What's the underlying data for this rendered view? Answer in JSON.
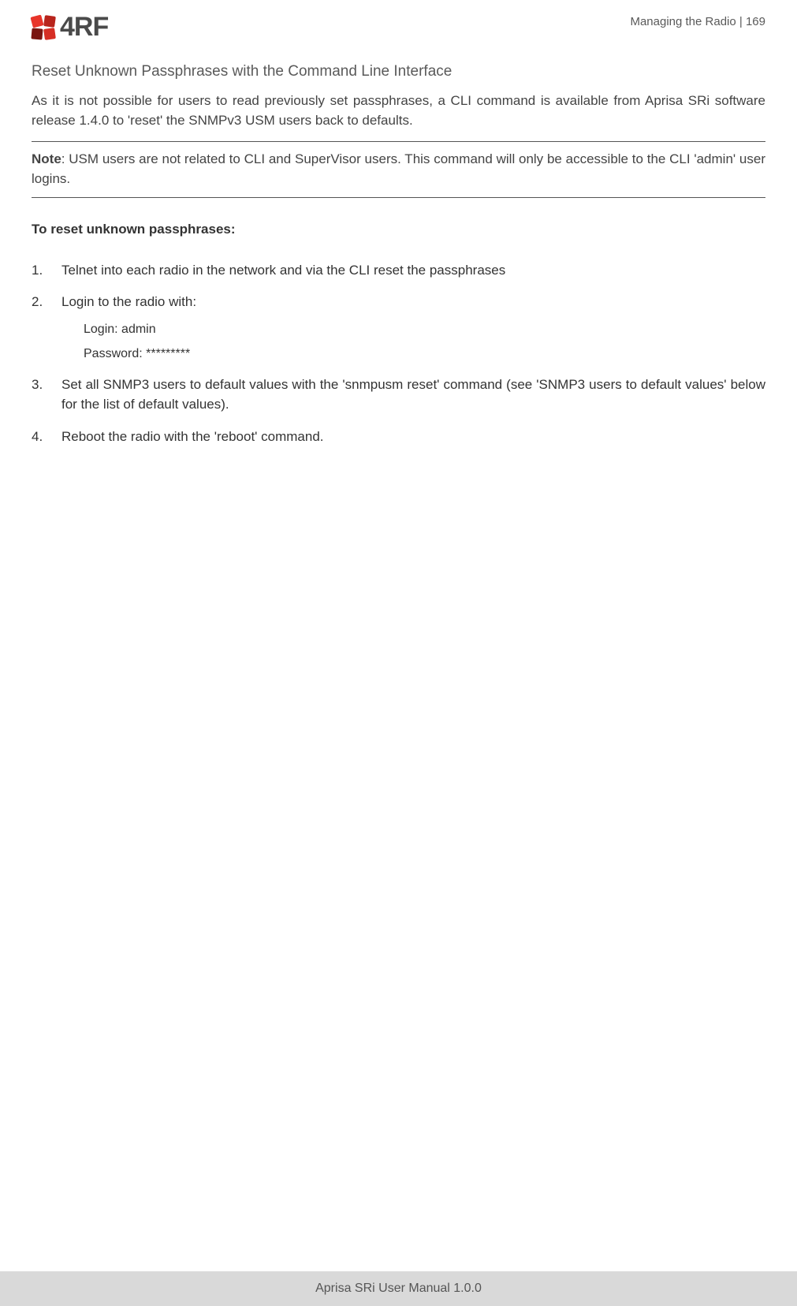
{
  "header": {
    "logo_text": "4RF",
    "section_name": "Managing the Radio",
    "separator": "  |  ",
    "page_number": "169"
  },
  "section_title": "Reset Unknown Passphrases with the Command Line Interface",
  "intro": "As it is not possible for users to read previously set passphrases, a CLI command is available from Aprisa SRi software release 1.4.0 to 'reset' the SNMPv3 USM users back to defaults.",
  "note": {
    "label": "Note",
    "text": ": USM users are not related to CLI and SuperVisor users.  This command will only be accessible to the CLI 'admin' user logins."
  },
  "subheading": "To reset unknown passphrases:",
  "steps": {
    "s1": "Telnet into each radio in the network and via the CLI reset the passphrases",
    "s2": "Login to the radio with:",
    "s2_login": "Login: admin",
    "s2_password": "Password: *********",
    "s3": "Set all SNMP3 users to default values with the 'snmpusm reset' command (see 'SNMP3 users to default values' below for the list of default values).",
    "s4": "Reboot the radio with the 'reboot' command."
  },
  "footer": "Aprisa SRi User Manual 1.0.0"
}
